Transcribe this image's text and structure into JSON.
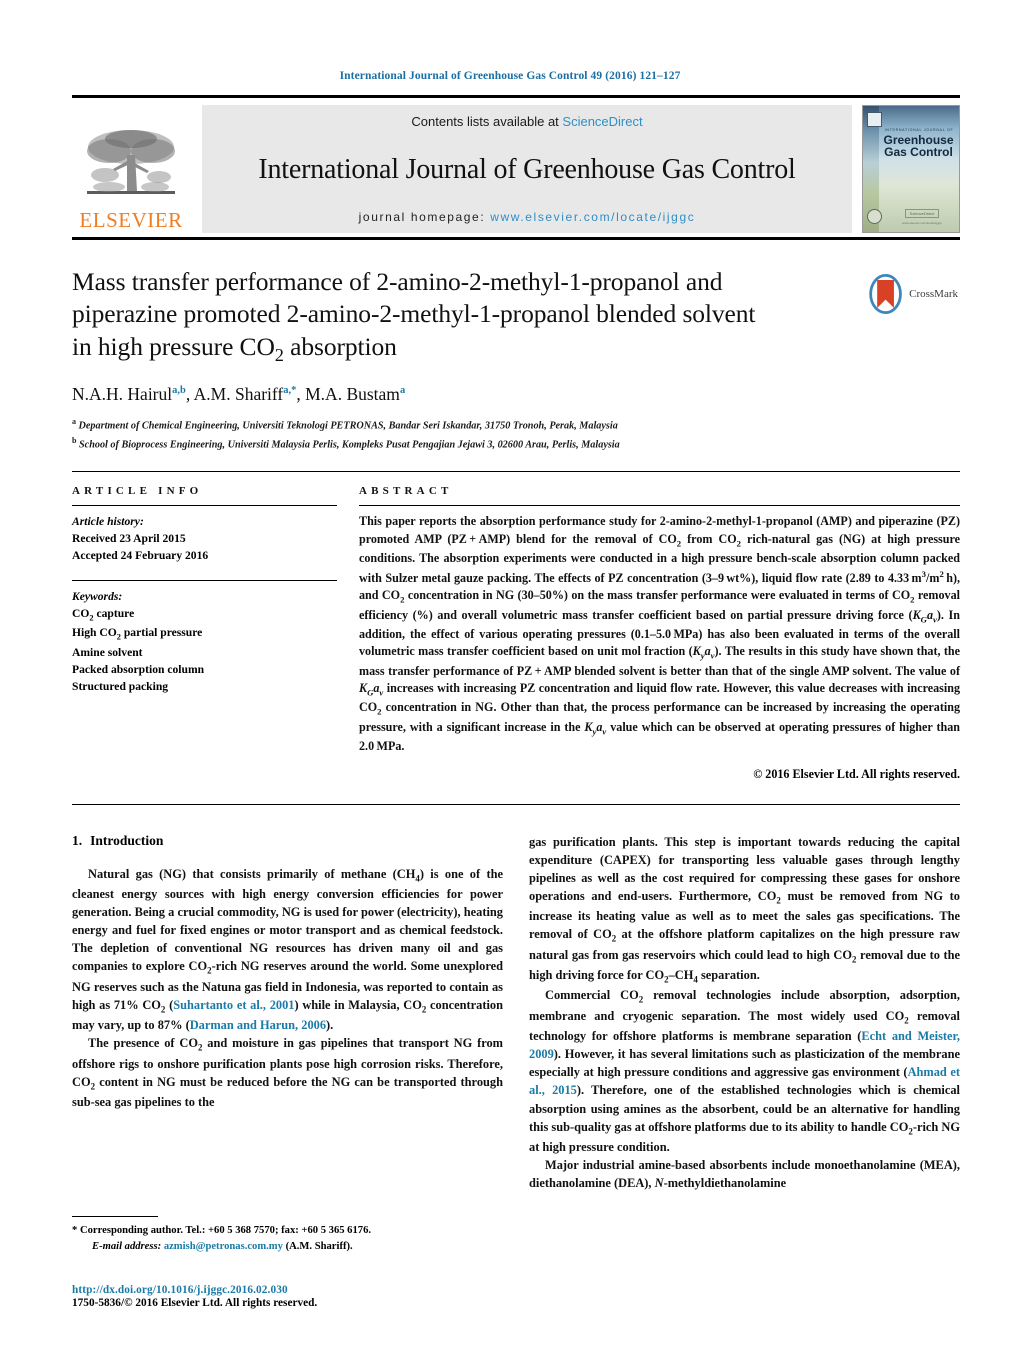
{
  "running_head": "International Journal of Greenhouse Gas Control 49 (2016) 121–127",
  "masthead": {
    "publisher": "ELSEVIER",
    "contents_prefix": "Contents lists available at ",
    "contents_link": "ScienceDirect",
    "journal_name": "International Journal of Greenhouse Gas Control",
    "homepage_prefix": "journal homepage: ",
    "homepage_url": "www.elsevier.com/locate/ijggc",
    "cover": {
      "kicker": "INTERNATIONAL JOURNAL OF",
      "line1": "Greenhouse",
      "line2": "Gas Control",
      "foot_box": "ScienceDirect",
      "foot_sub": "www.elsevier.com/locate/ijggc"
    }
  },
  "title": {
    "line1": "Mass transfer performance of 2-amino-2-methyl-1-propanol and",
    "line2": "piperazine promoted 2-amino-2-methyl-1-propanol blended solvent",
    "line3_pre": "in high pressure CO",
    "line3_sub": "2",
    "line3_post": " absorption"
  },
  "crossmark": {
    "label": "CrossMark"
  },
  "authors": {
    "a1_name": "N.A.H. Hairul",
    "a1_sup": "a,b",
    "sep1": ", ",
    "a2_name": "A.M. Shariff",
    "a2_sup": "a,*",
    "sep2": ", ",
    "a3_name": "M.A. Bustam",
    "a3_sup": "a"
  },
  "affiliations": [
    {
      "mark": "a",
      "text": "Department of Chemical Engineering, Universiti Teknologi PETRONAS, Bandar Seri Iskandar, 31750 Tronoh, Perak, Malaysia"
    },
    {
      "mark": "b",
      "text": "School of Bioprocess Engineering, Universiti Malaysia Perlis, Kompleks Pusat Pengajian Jejawi 3, 02600 Arau, Perlis, Malaysia"
    }
  ],
  "article_info": {
    "heading": "ARTICLE INFO",
    "history_label": "Article history:",
    "received": "Received 23 April 2015",
    "accepted": "Accepted 24 February 2016",
    "keywords_label": "Keywords:",
    "keywords": [
      "CO2 capture",
      "High CO2 partial pressure",
      "Amine solvent",
      "Packed absorption column",
      "Structured packing"
    ]
  },
  "abstract": {
    "heading": "ABSTRACT",
    "body": "This paper reports the absorption performance study for 2-amino-2-methyl-1-propanol (AMP) and piperazine (PZ) promoted AMP (PZ+AMP) blend for the removal of CO2 from CO2 rich-natural gas (NG) at high pressure conditions. The absorption experiments were conducted in a high pressure bench-scale absorption column packed with Sulzer metal gauze packing. The effects of PZ concentration (3–9 wt%), liquid flow rate (2.89 to 4.33 m3/m2 h), and CO2 concentration in NG (30–50%) on the mass transfer performance were evaluated in terms of CO2 removal efficiency (%) and overall volumetric mass transfer coefficient based on partial pressure driving force (KGav). In addition, the effect of various operating pressures (0.1–5.0 MPa) has also been evaluated in terms of the overall volumetric mass transfer coefficient based on unit mol fraction (Kyav). The results in this study have shown that, the mass transfer performance of PZ+AMP blended solvent is better than that of the single AMP solvent. The value of KGav increases with increasing PZ concentration and liquid flow rate. However, this value decreases with increasing CO2 concentration in NG. Other than that, the process performance can be increased by increasing the operating pressure, with a significant increase in the Kyav value which can be observed at operating pressures of higher than 2.0 MPa.",
    "copyright": "© 2016 Elsevier Ltd. All rights reserved."
  },
  "section": {
    "number": "1.",
    "title": "Introduction"
  },
  "paragraphs_left": [
    "Natural gas (NG) that consists primarily of methane (CH4) is one of the cleanest energy sources with high energy conversion efficiencies for power generation. Being a crucial commodity, NG is used for power (electricity), heating energy and fuel for fixed engines or motor transport and as chemical feedstock. The depletion of conventional NG resources has driven many oil and gas companies to explore CO2-rich NG reserves around the world. Some unexplored NG reserves such as the Natuna gas field in Indonesia, was reported to contain as high as 71% CO2 (Suhartanto et al., 2001) while in Malaysia, CO2 concentration may vary, up to 87% (Darman and Harun, 2006).",
    "The presence of CO2 and moisture in gas pipelines that transport NG from offshore rigs to onshore purification plants pose high corrosion risks. Therefore, CO2 content in NG must be reduced before the NG can be transported through sub-sea gas pipelines to the"
  ],
  "paragraphs_right": [
    "gas purification plants. This step is important towards reducing the capital expenditure (CAPEX) for transporting less valuable gases through lengthy pipelines as well as the cost required for compressing these gases for onshore operations and end-users. Furthermore, CO2 must be removed from NG to increase its heating value as well as to meet the sales gas specifications. The removal of CO2 at the offshore platform capitalizes on the high pressure raw natural gas from gas reservoirs which could lead to high CO2 removal due to the high driving force for CO2–CH4 separation.",
    "Commercial CO2 removal technologies include absorption, adsorption, membrane and cryogenic separation. The most widely used CO2 removal technology for offshore platforms is membrane separation (Echt and Meister, 2009). However, it has several limitations such as plasticization of the membrane especially at high pressure conditions and aggressive gas environment (Ahmad et al., 2015). Therefore, one of the established technologies which is chemical absorption using amines as the absorbent, could be an alternative for handling this sub-quality gas at offshore platforms due to its ability to handle CO2-rich NG at high pressure condition.",
    "Major industrial amine-based absorbents include monoethanolamine (MEA), diethanolamine (DEA), N-methyldiethanolamine"
  ],
  "citations_left": [
    "Suhartanto et al., 2001",
    "Darman and Harun, 2006"
  ],
  "citations_right": [
    "Echt and Meister, 2009",
    "Ahmad et al., 2015"
  ],
  "footnote": {
    "star": "*",
    "corresponding": "Corresponding author. Tel.: +60 5 368 7570; fax: +60 5 365 6176.",
    "email_label": "E-mail address:",
    "email": "azmish@petronas.com.my",
    "email_owner": "(A.M. Shariff)."
  },
  "footer": {
    "doi": "http://dx.doi.org/10.1016/j.ijggc.2016.02.030",
    "issn": "1750-5836/© 2016 Elsevier Ltd. All rights reserved."
  },
  "colors": {
    "link": "#1a7ba8",
    "elsevier_orange": "#ef7d22",
    "sciencedirect": "#2f8fc4"
  }
}
